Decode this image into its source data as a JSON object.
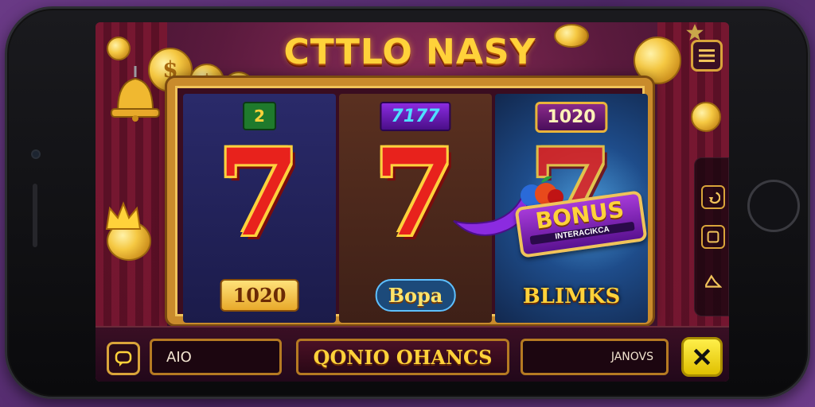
{
  "game": {
    "title": "CTTLO NASY"
  },
  "reels": [
    {
      "top_badge": "2",
      "symbol": "7",
      "bottom_label": "1020"
    },
    {
      "top_badge": "7177",
      "symbol": "7",
      "bottom_label": "Bopa"
    },
    {
      "top_badge": "1020",
      "symbol": "7",
      "bottom_label": "BLIMKS"
    }
  ],
  "bonus": {
    "title": "BONUS",
    "subtitle": "INTERACIKCA"
  },
  "bottom_bar": {
    "left_field": "AIO",
    "center_field": "QONIO OHANCS",
    "right_field": "JANOVS"
  },
  "colors": {
    "accent_gold": "#ffd23a",
    "frame_gold": "#c98b2c",
    "seven_red": "#e8221c",
    "spin_yellow": "#ffef4a"
  },
  "icons": {
    "menu": "menu-icon",
    "chat": "chat-icon",
    "spin": "close-icon",
    "side_back": "back-icon",
    "side_square": "square-icon",
    "side_sound": "sound-icon"
  }
}
